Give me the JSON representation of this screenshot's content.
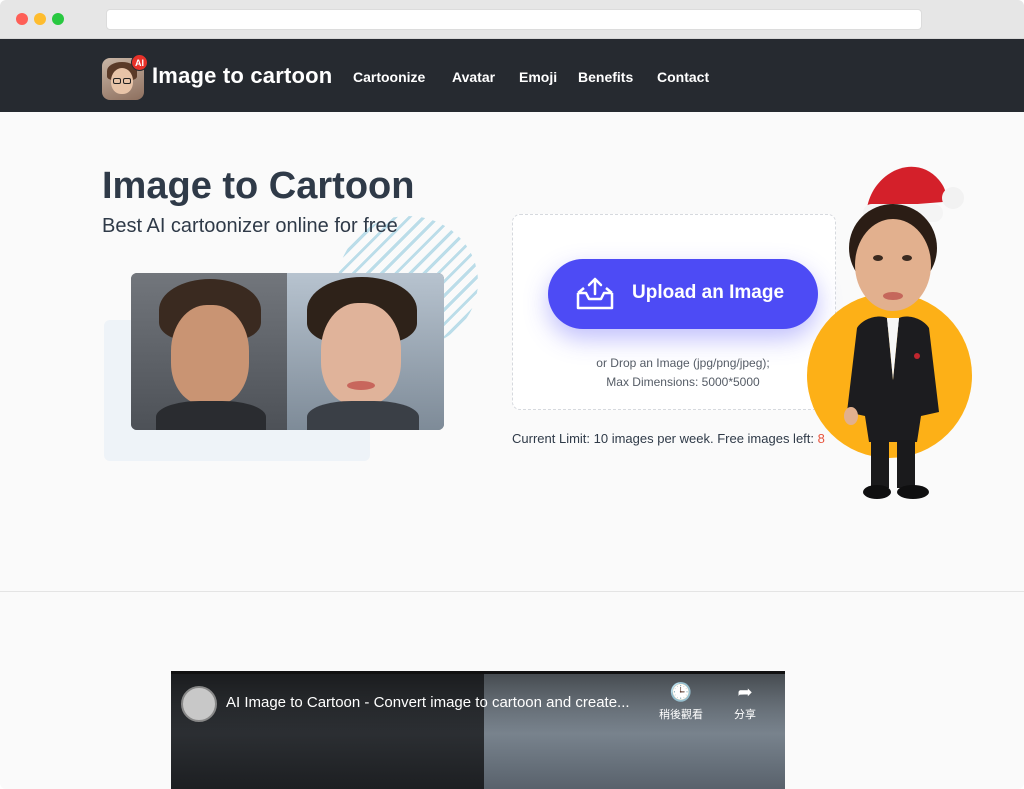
{
  "browser": {
    "url": ""
  },
  "nav": {
    "brand": "Image to cartoon",
    "logo_badge": "AI",
    "links": [
      "Cartoonize",
      "Avatar",
      "Emoji",
      "Benefits",
      "Contact"
    ]
  },
  "hero": {
    "title": "Image to Cartoon",
    "subtitle": "Best AI cartoonizer online for free"
  },
  "upload": {
    "button_label": "Upload an Image",
    "drop_hint_line1": "or Drop an Image (jpg/png/jpeg);",
    "drop_hint_line2": "Max Dimensions: 5000*5000",
    "limit_text": "Current Limit: 10 images per week. Free images left: ",
    "images_left": "8"
  },
  "video": {
    "title": "AI Image to Cartoon - Convert image to cartoon and create...",
    "watch_later": "稍後觀看",
    "share": "分享"
  },
  "colors": {
    "nav_bg": "#262a30",
    "accent": "#4d4bf5",
    "orange": "#fdb017",
    "count_red": "#e8553f"
  }
}
